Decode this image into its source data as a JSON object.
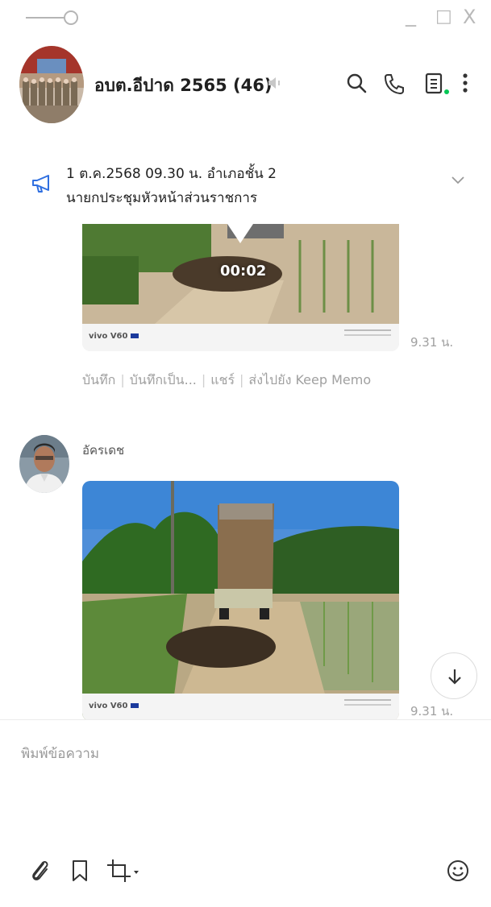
{
  "window": {
    "minimize_label": "_",
    "maximize_label": "□",
    "close_label": "X"
  },
  "header": {
    "group_name": "อบต.อีปาด 2565 (46)"
  },
  "announcement": {
    "line1": "1 ต.ค.2568 09.30 น. อำเภอชั้น 2",
    "line2": "นายกประชุมหัวหน้าส่วนราชการ"
  },
  "messages": [
    {
      "type": "video",
      "duration": "00:02",
      "watermark": "vivo V60",
      "time": "9.31 น.",
      "actions": [
        "บันทึก",
        "บันทึกเป็น...",
        "แชร์",
        "ส่งไปยัง Keep Memo"
      ]
    },
    {
      "type": "image",
      "sender": "อัครเดช",
      "watermark": "vivo V60",
      "time": "9.31 น."
    }
  ],
  "composer": {
    "placeholder": "พิมพ์ข้อความ"
  },
  "colors": {
    "online_dot": "#06c755",
    "announce_icon": "#2f6fe0"
  }
}
